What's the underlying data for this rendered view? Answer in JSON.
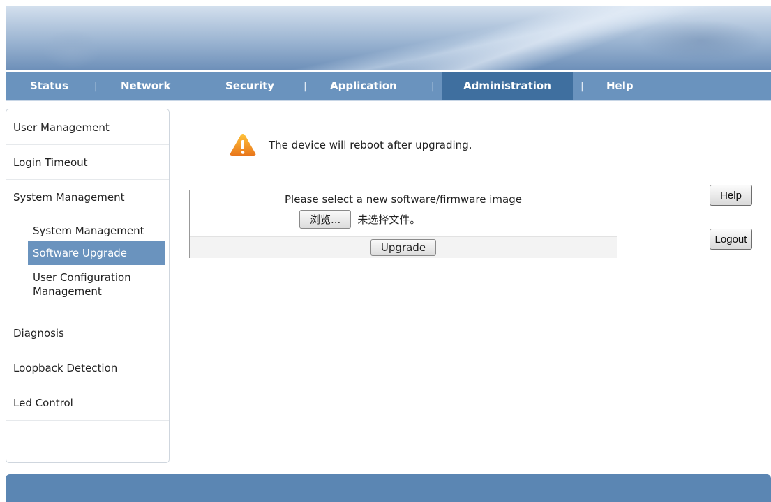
{
  "nav": {
    "items": [
      {
        "label": "Status"
      },
      {
        "label": "Network"
      },
      {
        "label": "Security"
      },
      {
        "label": "Application"
      },
      {
        "label": "Administration",
        "active": true
      },
      {
        "label": "Help"
      }
    ],
    "separator": "|"
  },
  "sidebar": {
    "items": [
      {
        "label": "User Management"
      },
      {
        "label": "Login Timeout"
      },
      {
        "label": "System Management"
      }
    ],
    "sub_items": [
      {
        "label": "System Management"
      },
      {
        "label": "Software Upgrade",
        "active": true
      },
      {
        "label": "User Configuration Management"
      }
    ],
    "items_after": [
      {
        "label": "Diagnosis"
      },
      {
        "label": "Loopback Detection"
      },
      {
        "label": "Led Control"
      }
    ]
  },
  "warning": {
    "icon": "warning-triangle-icon",
    "text": "The device will reboot after upgrading."
  },
  "upgrade": {
    "title": "Please select a new software/firmware image",
    "browse_label": "浏览...",
    "file_status": "未选择文件。",
    "upgrade_label": "Upgrade"
  },
  "buttons": {
    "help_label": "Help",
    "logout_label": "Logout"
  },
  "colors": {
    "nav_bg": "#6a93be",
    "nav_active_bg": "#3f6f9f",
    "sidebar_active_bg": "#6a93be",
    "footer_bg": "#5b86b3",
    "warning_orange": "#f0901e"
  }
}
